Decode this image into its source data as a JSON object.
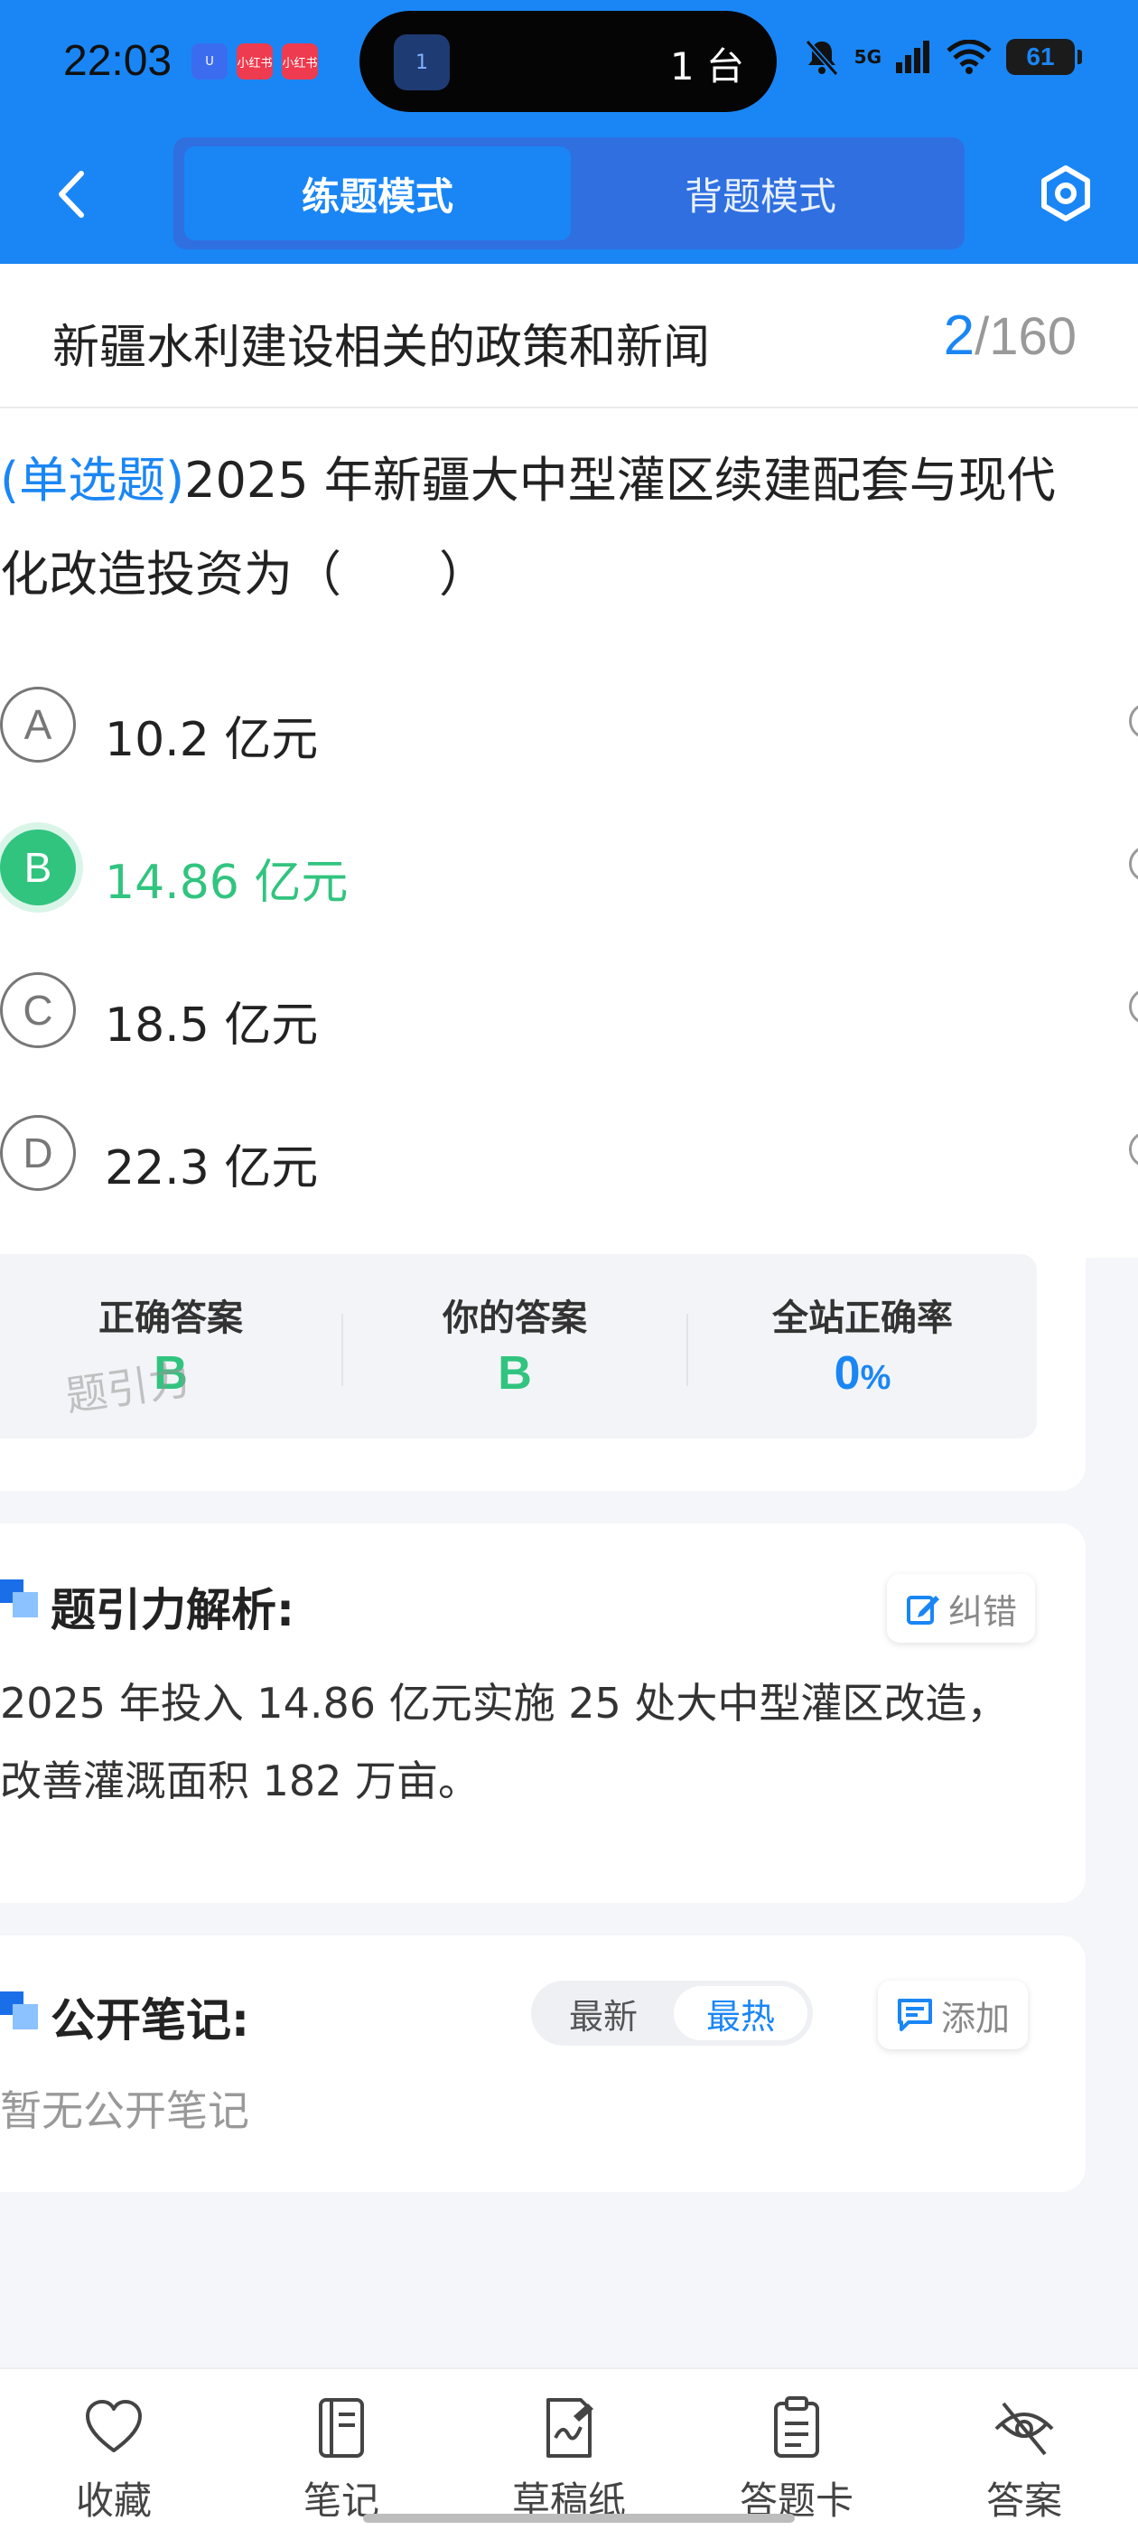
{
  "status_bar": {
    "time": "22:03",
    "apps": [
      {
        "icon": "download-app-icon",
        "label": "U",
        "color": "#3b6cf0"
      },
      {
        "icon": "xiaohongshu-icon",
        "label": "小红书",
        "color": "#ef3b4f"
      },
      {
        "icon": "xiaohongshu-icon",
        "label": "小红书",
        "color": "#ef3b4f"
      }
    ],
    "island_badge": "1",
    "island_text": "1 台",
    "network": "5G",
    "battery": "61"
  },
  "header": {
    "tabs": [
      {
        "label": "练题模式",
        "active": true
      },
      {
        "label": "背题模式",
        "active": false
      }
    ],
    "accent_color": "#1a86f5"
  },
  "title_row": {
    "title": "新疆水利建设相关的政策和新闻",
    "current": "2",
    "total": "/160"
  },
  "question": {
    "type_label": "(单选题)",
    "text": "2025 年新疆大中型灌区续建配套与现代化改造投资为（　　）",
    "options": [
      {
        "letter": "A",
        "text": "10.2 亿元",
        "selected": false
      },
      {
        "letter": "B",
        "text": "14.86 亿元",
        "selected": true
      },
      {
        "letter": "C",
        "text": "18.5 亿元",
        "selected": false
      },
      {
        "letter": "D",
        "text": "22.3 亿元",
        "selected": false
      }
    ]
  },
  "result": {
    "correct_label": "正确答案",
    "correct_value": "B",
    "yours_label": "你的答案",
    "yours_value": "B",
    "rate_label": "全站正确率",
    "rate_value": "0",
    "rate_unit": "%",
    "watermark": "题引力"
  },
  "analysis": {
    "title": "题引力解析:",
    "report_label": "纠错",
    "text": "2025 年投入 14.86 亿元实施 25 处大中型灌区改造，改善灌溉面积 182 万亩。"
  },
  "notes": {
    "title": "公开笔记:",
    "sort_options": [
      "最新",
      "最热"
    ],
    "sort_active": "最热",
    "add_label": "添加",
    "empty_text": "暂无公开笔记"
  },
  "bottom_bar": {
    "items": [
      {
        "label": "收藏",
        "icon": "heart-icon"
      },
      {
        "label": "笔记",
        "icon": "notebook-icon"
      },
      {
        "label": "草稿纸",
        "icon": "draft-paper-icon"
      },
      {
        "label": "答题卡",
        "icon": "answer-sheet-icon"
      },
      {
        "label": "答案",
        "icon": "eye-off-icon"
      }
    ]
  }
}
